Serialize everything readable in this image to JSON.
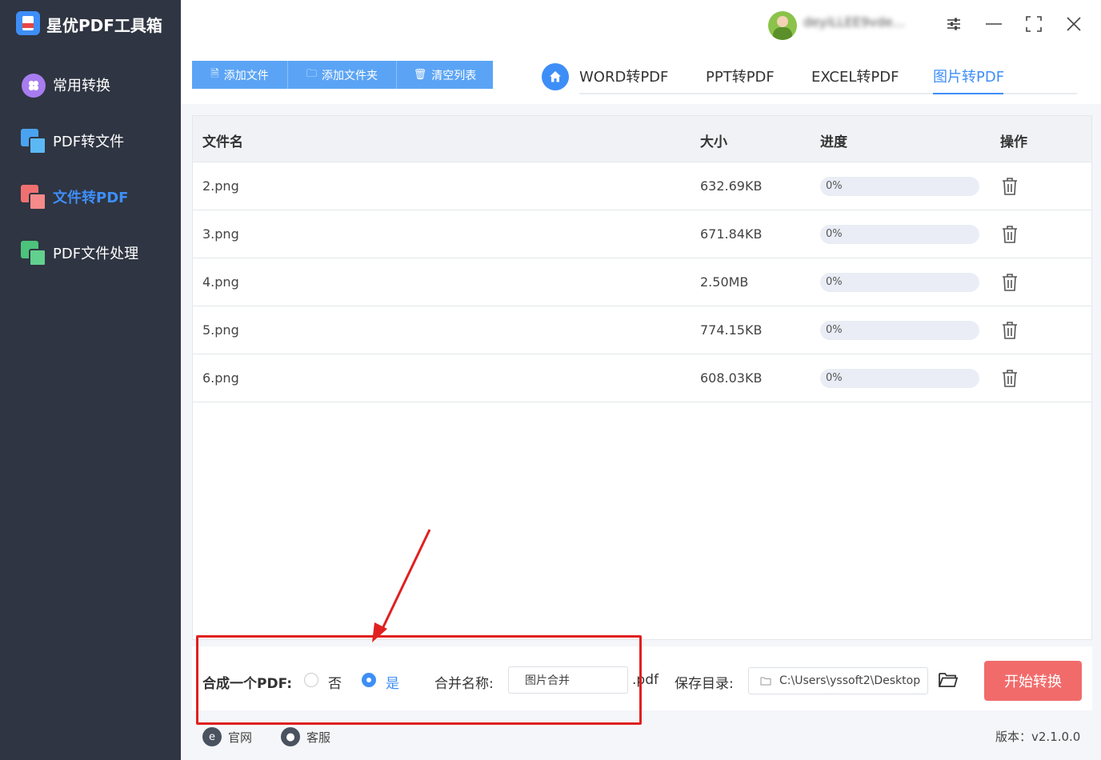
{
  "app": {
    "title": "星优PDF工具箱",
    "username": "deyiLLEE9vde..."
  },
  "sidebar": {
    "items": [
      {
        "label": "常用转换",
        "active": false
      },
      {
        "label": "PDF转文件",
        "active": false
      },
      {
        "label": "文件转PDF",
        "active": true
      },
      {
        "label": "PDF文件处理",
        "active": false
      }
    ]
  },
  "toolbar": {
    "add_file": "添加文件",
    "add_folder": "添加文件夹",
    "clear_list": "清空列表"
  },
  "tabs": [
    {
      "label": "WORD转PDF",
      "active": false
    },
    {
      "label": "PPT转PDF",
      "active": false
    },
    {
      "label": "EXCEL转PDF",
      "active": false
    },
    {
      "label": "图片转PDF",
      "active": true
    }
  ],
  "table": {
    "columns": [
      "文件名",
      "大小",
      "进度",
      "操作"
    ],
    "rows": [
      {
        "name": "2.png",
        "size": "632.69KB",
        "progress": "0%"
      },
      {
        "name": "3.png",
        "size": "671.84KB",
        "progress": "0%"
      },
      {
        "name": "4.png",
        "size": "2.50MB",
        "progress": "0%"
      },
      {
        "name": "5.png",
        "size": "774.15KB",
        "progress": "0%"
      },
      {
        "name": "6.png",
        "size": "608.03KB",
        "progress": "0%"
      }
    ]
  },
  "options": {
    "merge_label": "合成一个PDF:",
    "no_label": "否",
    "yes_label": "是",
    "merge_selected": "是",
    "merge_name_label": "合并名称:",
    "merge_name_value": "图片合并",
    "ext": ".pdf",
    "save_dir_label": "保存目录:",
    "save_dir_value": "C:\\Users\\yssoft2\\Desktop",
    "start_button": "开始转换"
  },
  "footer": {
    "website": "官网",
    "support": "客服",
    "version": "版本：v2.1.0.0"
  },
  "colors": {
    "sidebar_bg": "#2f3542",
    "accent": "#3e8ef7",
    "start_button": "#f26b6b",
    "highlight": "#e02020"
  }
}
